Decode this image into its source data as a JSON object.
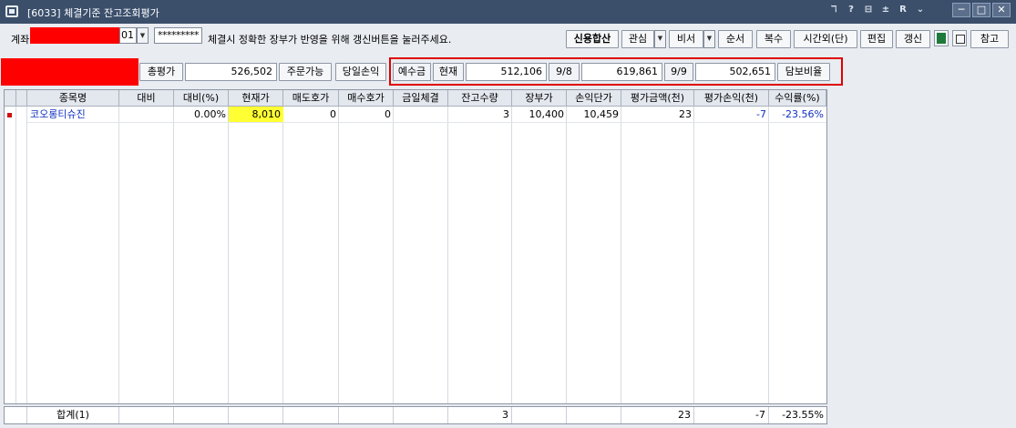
{
  "window": {
    "title": "[6033] 체결기준 잔고조회평가",
    "titlebar_icons": [
      "ℸ",
      "?",
      "⊟",
      "±",
      "R",
      "⌄"
    ],
    "controls": {
      "minimize": "─",
      "maximize": "□",
      "close": "✕"
    }
  },
  "toolbar": {
    "account_label": "계좌",
    "account_suffix": "01",
    "password": "*********",
    "notice": "체결시 정확한 장부가 반영을 위해 갱신버튼을 눌러주세요.",
    "buttons": {
      "credit_sum": "신용합산",
      "interest": "관심",
      "secretary": "비서",
      "order": "순서",
      "multi": "복수",
      "after_hours": "시간외(단)",
      "edit": "편집",
      "refresh": "갱신",
      "reference": "참고"
    }
  },
  "summary": {
    "total_eval_label": "총평가",
    "total_eval_value": "526,502",
    "orderable_label": "주문가능",
    "daily_pnl_label": "당일손익",
    "deposit_label": "예수금",
    "current_label": "현재",
    "current_value": "512,106",
    "d1_label": "9/8",
    "d1_value": "619,861",
    "d2_label": "9/9",
    "d2_value": "502,651",
    "collateral_ratio_label": "담보비율"
  },
  "grid": {
    "headers": [
      "종목명",
      "대비",
      "대비(%)",
      "현재가",
      "매도호가",
      "매수호가",
      "금일체결",
      "잔고수량",
      "장부가",
      "손익단가",
      "평가금액(천)",
      "평가손익(천)",
      "수익률(%)"
    ],
    "rows": [
      {
        "name": "코오롱티슈진",
        "change": "",
        "change_pct": "0.00%",
        "price": "8,010",
        "ask": "0",
        "bid": "0",
        "today_exec": "",
        "qty": "3",
        "book_price": "10,400",
        "pnl_unit": "10,459",
        "eval_amt": "23",
        "eval_pnl": "-7",
        "return_pct": "-23.56%"
      }
    ],
    "totals": {
      "label": "합계(1)",
      "qty": "3",
      "eval_amt": "23",
      "eval_pnl": "-7",
      "return_pct": "-23.55%"
    }
  },
  "colors": {
    "titlebar": "#3b4f6b",
    "panel": "#e9ecf1",
    "redact": "#ff0000",
    "highlight_price": "#ffff33",
    "negative_blue": "#1030c0"
  }
}
